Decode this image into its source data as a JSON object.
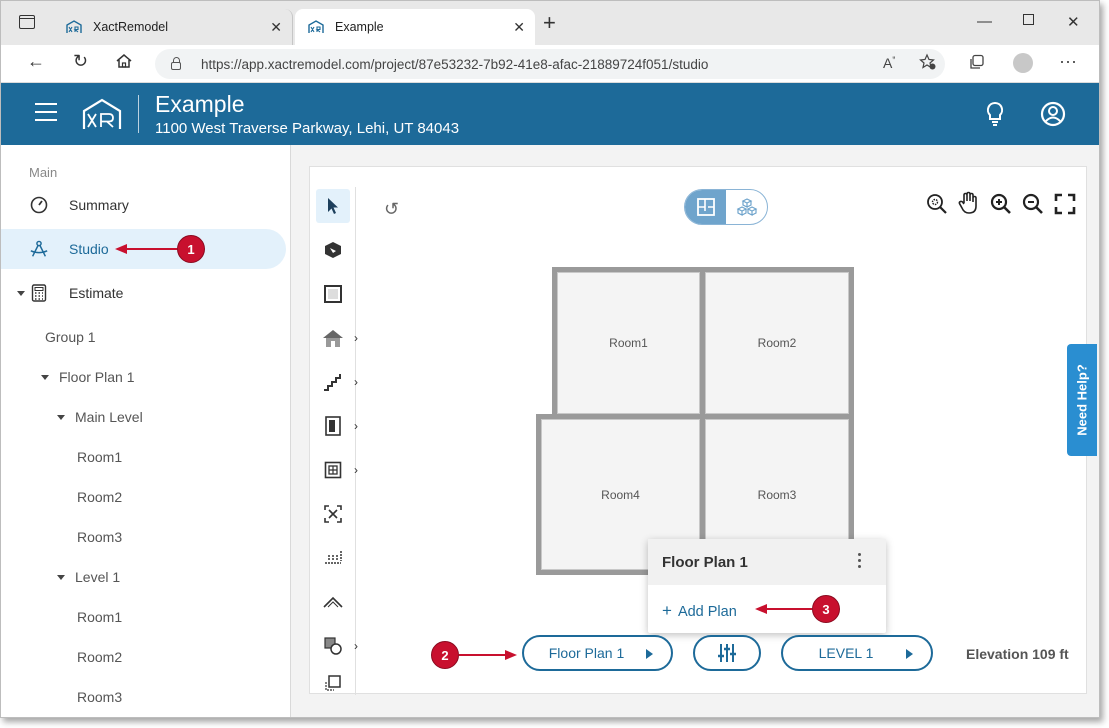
{
  "browser": {
    "tabs": [
      {
        "label": "XactRemodel",
        "active": false
      },
      {
        "label": "Example",
        "active": true
      }
    ],
    "url": "https://app.xactremodel.com/project/87e53232-7b92-41e8-afac-21889724f051/studio"
  },
  "header": {
    "project_name": "Example",
    "project_address": "1100 West Traverse Parkway, Lehi, UT 84043"
  },
  "sidebar": {
    "section_label": "Main",
    "nav": [
      {
        "label": "Summary",
        "icon": "gauge-icon"
      },
      {
        "label": "Studio",
        "icon": "compass-icon",
        "selected": true
      },
      {
        "label": "Estimate",
        "icon": "calculator-icon"
      }
    ],
    "tree": {
      "group": "Group 1",
      "plan": "Floor Plan 1",
      "levels": [
        {
          "label": "Main Level",
          "rooms": [
            "Room1",
            "Room2",
            "Room3"
          ]
        },
        {
          "label": "Level 1",
          "rooms": [
            "Room1",
            "Room2",
            "Room3"
          ]
        }
      ]
    }
  },
  "canvas": {
    "rooms": [
      "Room1",
      "Room2",
      "Room4",
      "Room3"
    ],
    "popup": {
      "title": "Floor Plan 1",
      "add_label": "Add Plan"
    },
    "bottom": {
      "plan_button": "Floor Plan 1",
      "level_button": "LEVEL 1",
      "elevation": "Elevation 109 ft"
    }
  },
  "need_help": "Need Help?",
  "callouts": [
    "1",
    "2",
    "3"
  ],
  "colors": {
    "header_bg": "#1d6a99",
    "accent": "#1d6a99",
    "callout": "#c8102e",
    "need_help": "#2a8ed1",
    "selected_bg": "#e3f1fb"
  }
}
